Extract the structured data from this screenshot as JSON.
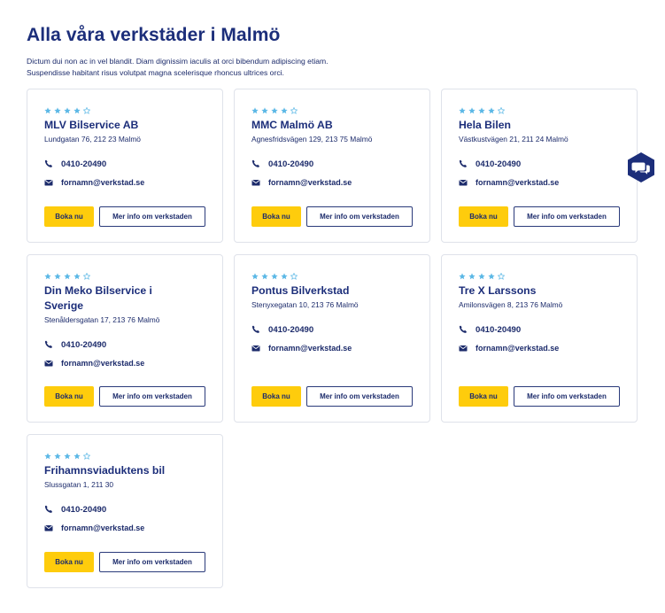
{
  "page": {
    "title": "Alla våra verkstäder i Malmö",
    "intro": "Dictum dui non ac in vel blandit. Diam dignissim iaculis at orci bibendum adipiscing etiam. Suspendisse habitant risus volutpat magna scelerisque rhoncus ultrices orci."
  },
  "colors": {
    "primary": "#1c2e7a",
    "accent": "#fecc0c",
    "star": "#5cb8e6",
    "border": "#dfe2ea"
  },
  "workshops": [
    {
      "name": "MLV Bilservice AB",
      "address": "Lundgatan 76, 212 23 Malmö",
      "phone": "0410-20490",
      "email": "fornamn@verkstad.se",
      "rating": 4,
      "max_rating": 5,
      "book_label": "Boka nu",
      "info_label": "Mer info om verkstaden"
    },
    {
      "name": "MMC Malmö AB",
      "address": "Agnesfridsvägen 129, 213 75 Malmö",
      "phone": "0410-20490",
      "email": "fornamn@verkstad.se",
      "rating": 4,
      "max_rating": 5,
      "book_label": "Boka nu",
      "info_label": "Mer info om verkstaden"
    },
    {
      "name": "Hela Bilen",
      "address": "Västkustvägen 21, 211 24 Malmö",
      "phone": "0410-20490",
      "email": "fornamn@verkstad.se",
      "rating": 4,
      "max_rating": 5,
      "book_label": "Boka nu",
      "info_label": "Mer info om verkstaden"
    },
    {
      "name": "Din Meko Bilservice i Sverige",
      "address": "Stenåldersgatan 17, 213 76 Malmö",
      "phone": "0410-20490",
      "email": "fornamn@verkstad.se",
      "rating": 4,
      "max_rating": 5,
      "book_label": "Boka nu",
      "info_label": "Mer info om verkstaden"
    },
    {
      "name": "Pontus Bilverkstad",
      "address": "Stenyxegatan 10, 213 76 Malmö",
      "phone": "0410-20490",
      "email": "fornamn@verkstad.se",
      "rating": 4,
      "max_rating": 5,
      "book_label": "Boka nu",
      "info_label": "Mer info om verkstaden"
    },
    {
      "name": "Tre X Larssons",
      "address": "Amilonsvägen 8, 213 76 Malmö",
      "phone": "0410-20490",
      "email": "fornamn@verkstad.se",
      "rating": 4,
      "max_rating": 5,
      "book_label": "Boka nu",
      "info_label": "Mer info om verkstaden"
    },
    {
      "name": "Frihamnsviaduktens bil",
      "address": "Slussgatan 1, 211 30",
      "phone": "0410-20490",
      "email": "fornamn@verkstad.se",
      "rating": 4,
      "max_rating": 5,
      "book_label": "Boka nu",
      "info_label": "Mer info om verkstaden"
    }
  ],
  "icons": {
    "phone": "phone-icon",
    "email": "envelope-icon",
    "star": "star-icon",
    "chat": "chat-bubbles-icon"
  }
}
